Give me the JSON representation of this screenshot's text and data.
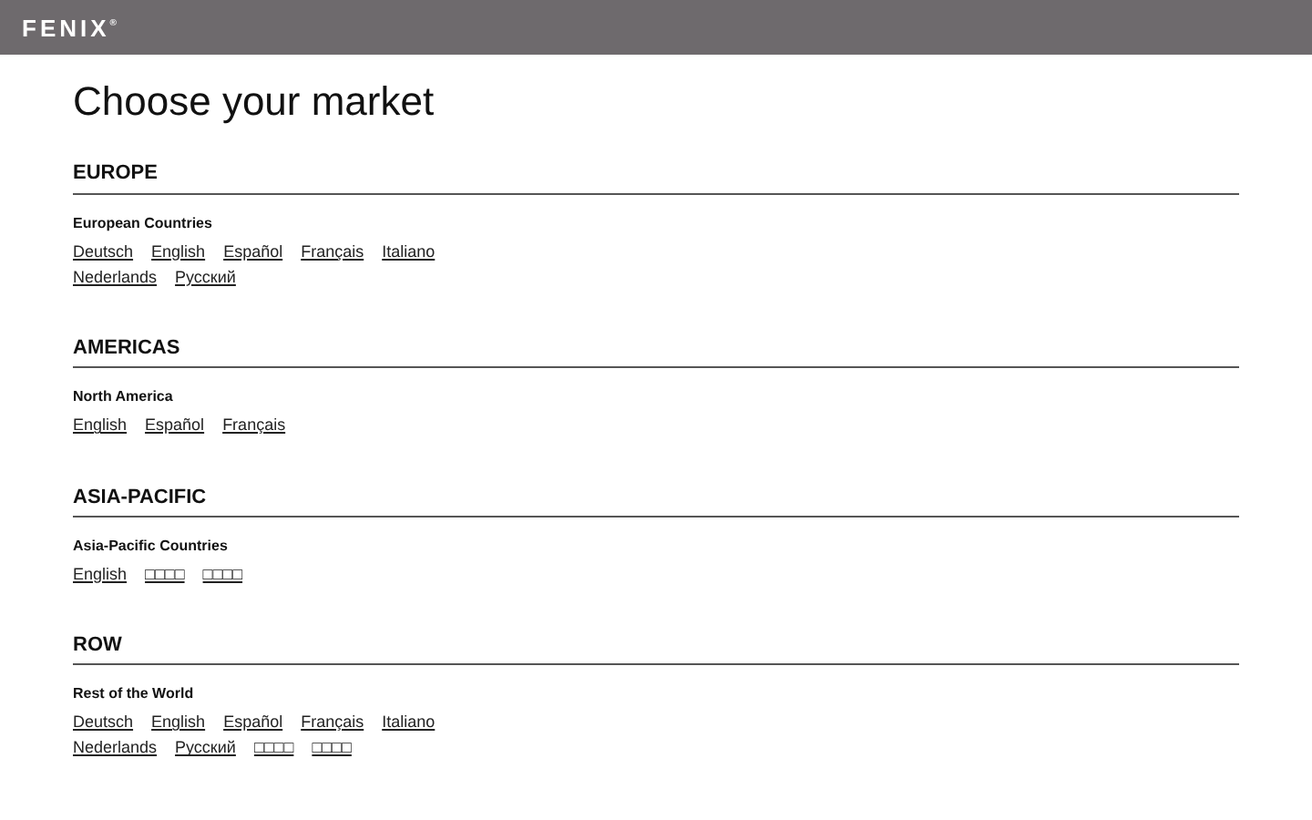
{
  "header": {
    "logo": "FENIX$^{®}$"
  },
  "title": "Choose your market",
  "regions": [
    {
      "name": "EUROPE",
      "groups": [
        {
          "label": "European Countries",
          "links": [
            "Deutsch",
            "English",
            "Español",
            "Français",
            "Italiano",
            "Nederlands",
            "Русский"
          ]
        }
      ]
    },
    {
      "name": "AMERICAS",
      "groups": [
        {
          "label": "North America",
          "links": [
            "English",
            "Español",
            "Français"
          ]
        }
      ]
    },
    {
      "name": "ASIA-PACIFIC",
      "groups": [
        {
          "label": "Asia-Pacific Countries",
          "links": [
            "English",
            "□□□□",
            "□□□□"
          ]
        }
      ]
    },
    {
      "name": "ROW",
      "groups": [
        {
          "label": "Rest of the World",
          "links": [
            "Deutsch",
            "English",
            "Español",
            "Français",
            "Italiano",
            "Nederlands",
            "Русский",
            "□□□□",
            "□□□□"
          ]
        }
      ]
    }
  ]
}
